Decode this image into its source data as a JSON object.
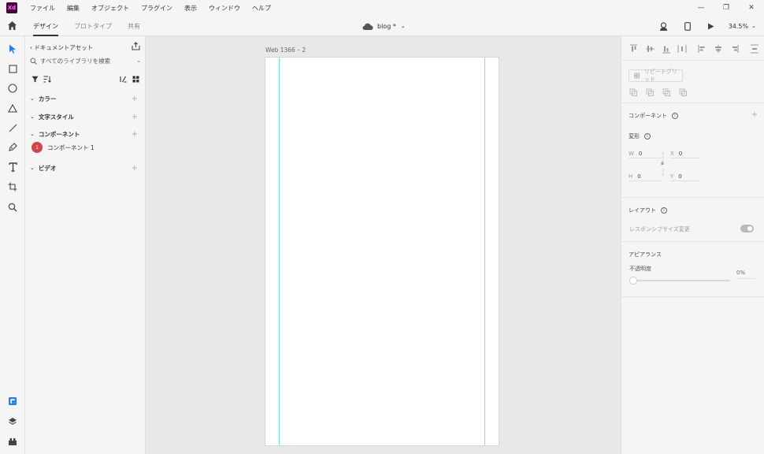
{
  "app": {
    "logo": "Xd"
  },
  "menu": [
    "ファイル",
    "編集",
    "オブジェクト",
    "プラグイン",
    "表示",
    "ウィンドウ",
    "ヘルプ"
  ],
  "window_controls": {
    "minimize": "—",
    "maximize": "❐",
    "close": "✕"
  },
  "tabs": [
    {
      "label": "デザイン",
      "active": true
    },
    {
      "label": "プロトタイプ",
      "active": false
    },
    {
      "label": "共有",
      "active": false
    }
  ],
  "document": {
    "name": "blog *",
    "chevron": "⌄"
  },
  "zoom": {
    "value": "34.5%",
    "chevron": "⌄"
  },
  "assets": {
    "back_label": "‹ ドキュメントアセット",
    "search_placeholder": "すべてのライブラリを検索",
    "search_chevron": "⌄",
    "sections": [
      {
        "caret": "⌄",
        "label": "カラー",
        "plus": "+"
      },
      {
        "caret": "⌄",
        "label": "文字スタイル",
        "plus": "+"
      },
      {
        "caret": "⌄",
        "label": "コンポーネント",
        "plus": "+"
      },
      {
        "caret": "⌄",
        "label": "ビデオ",
        "plus": "+"
      }
    ],
    "component_item": {
      "badge": "1",
      "label": "コンポーネント 1"
    }
  },
  "canvas": {
    "artboard_label": "Web 1366 – 2"
  },
  "props": {
    "repeat_grid": "リピートグリッド",
    "component_title": "コンポーネント",
    "component_plus": "+",
    "transform_title": "変形",
    "info_glyph": "i",
    "w_label": "W",
    "w_value": "0",
    "h_label": "H",
    "h_value": "0",
    "x_label": "X",
    "x_value": "0",
    "y_label": "Y",
    "y_value": "0",
    "layout_title": "レイアウト",
    "responsive_label": "レスポンシブサイズ変更",
    "appearance_title": "アピアランス",
    "opacity_label": "不透明度",
    "opacity_value": "0%",
    "opacity": 0
  },
  "colors": {
    "accent": "#2680eb",
    "guide": "#6fe6ec",
    "badge": "#d0464b",
    "xd_bg": "#470137",
    "xd_fg": "#ff61f6"
  }
}
